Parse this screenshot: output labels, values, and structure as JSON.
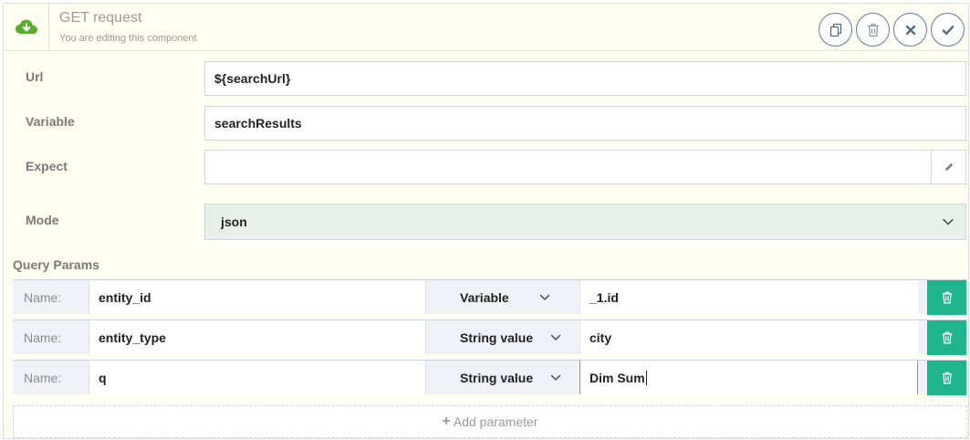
{
  "header": {
    "title": "GET request",
    "subtitle": "You are editing this component",
    "icon": "cloud-download-icon",
    "icon_color": "#5aab2e",
    "actions": [
      "duplicate",
      "delete",
      "cancel",
      "confirm"
    ]
  },
  "form": {
    "url": {
      "label": "Url",
      "value": "${searchUrl}"
    },
    "variable": {
      "label": "Variable",
      "value": "searchResults"
    },
    "expect": {
      "label": "Expect",
      "value": ""
    },
    "mode": {
      "label": "Mode",
      "value": "json"
    }
  },
  "query_params": {
    "label": "Query Params",
    "name_label": "Name:",
    "rows": [
      {
        "name": "entity_id",
        "type": "Variable",
        "value": "_1.id"
      },
      {
        "name": "entity_type",
        "type": "String value",
        "value": "city"
      },
      {
        "name": "q",
        "type": "String value",
        "value": "Dim Sum"
      }
    ],
    "delete_color": "#1fb48c",
    "add_label": "Add parameter"
  }
}
